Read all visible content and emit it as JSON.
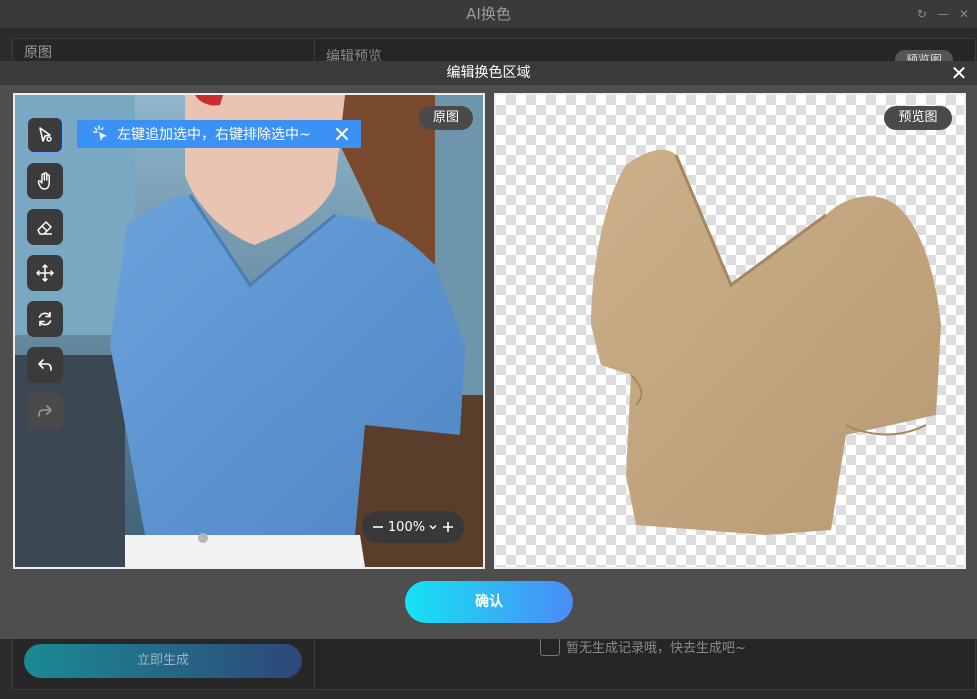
{
  "app": {
    "title": "AI换色"
  },
  "background": {
    "left_title": "原图",
    "right_title": "编辑预览",
    "preview_badge": "预览图",
    "generate_button": "立即生成",
    "empty_hint": "暂无生成记录哦，快去生成吧~"
  },
  "modal": {
    "title": "编辑换色区域",
    "left_badge": "原图",
    "right_badge": "预览图",
    "hint": "左键追加选中，右键排除选中~",
    "zoom": "100%",
    "confirm": "确认"
  },
  "tools": [
    {
      "name": "select-tool",
      "icon": "cursor-select-icon",
      "active": true
    },
    {
      "name": "hand-tool",
      "icon": "hand-icon",
      "active": false
    },
    {
      "name": "eraser-tool",
      "icon": "eraser-icon",
      "active": false
    },
    {
      "name": "move-tool",
      "icon": "move-icon",
      "active": false
    },
    {
      "name": "reset-tool",
      "icon": "refresh-icon",
      "active": false
    },
    {
      "name": "undo-tool",
      "icon": "undo-icon",
      "active": false
    },
    {
      "name": "redo-tool",
      "icon": "redo-icon",
      "active": false
    }
  ],
  "colors": {
    "accent": "#3c92f4",
    "shirt_original": "#5f95d2",
    "shirt_preview": "#c7ad88",
    "confirm_gradient": [
      "#15e3f3",
      "#4b8bf7"
    ]
  }
}
